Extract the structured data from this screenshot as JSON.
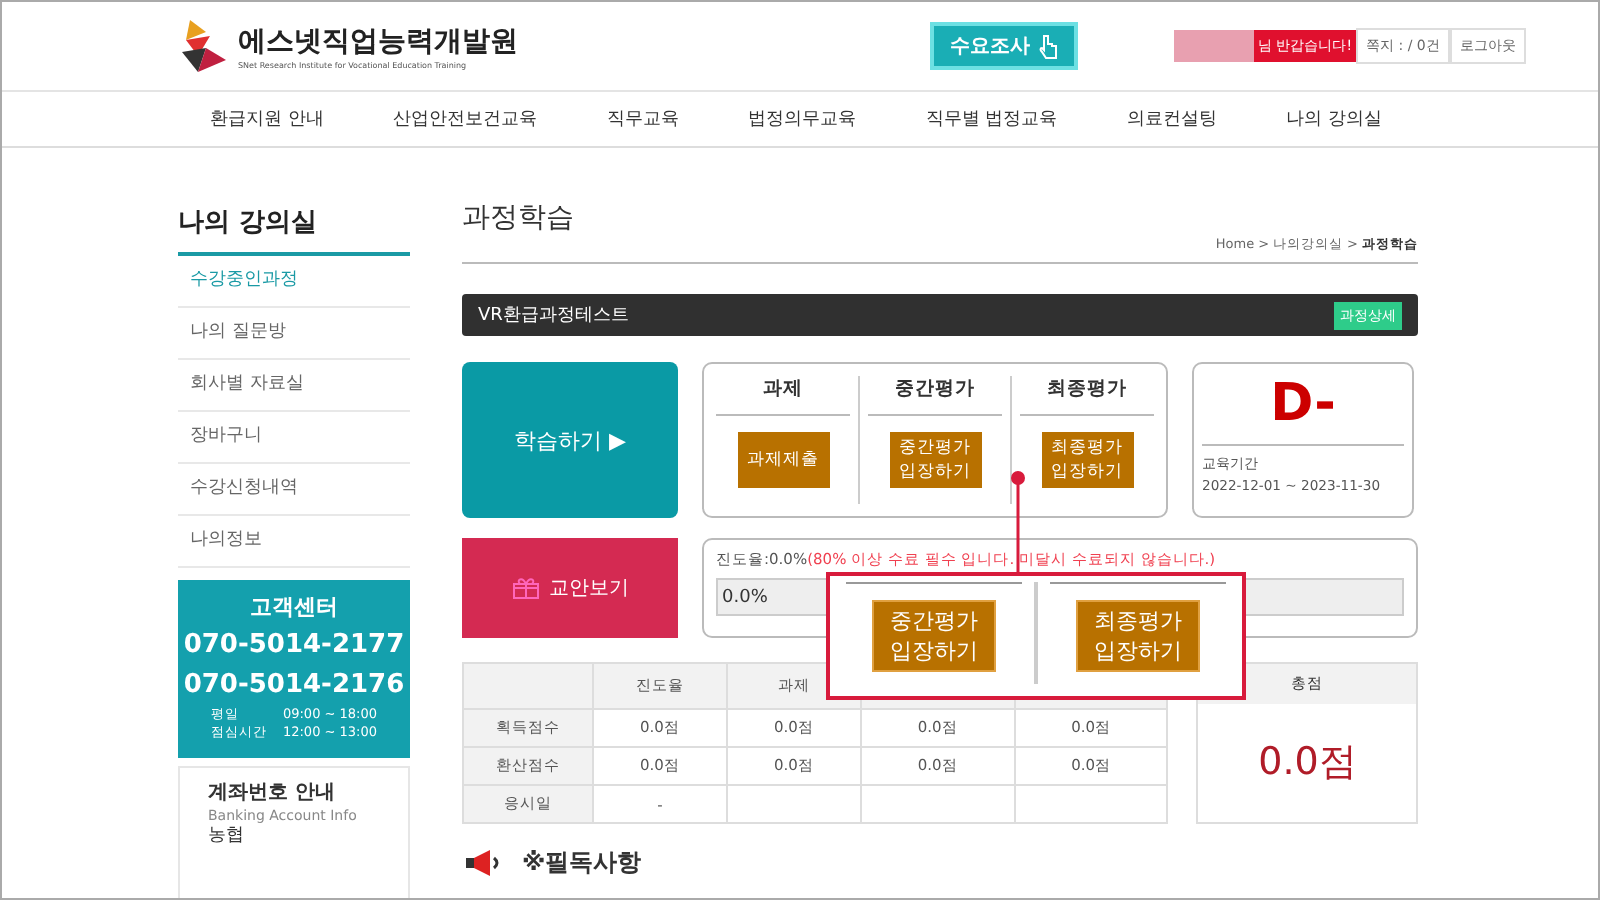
{
  "header": {
    "logo_title": "에스넷직업능력개발원",
    "logo_subtitle": "SNet Research Institute for Vocational Education Training",
    "survey_button": "수요조사",
    "greeting": "님 반갑습니다!",
    "messages": "쪽지 : / 0건",
    "logout": "로그아웃"
  },
  "nav": [
    "환급지원 안내",
    "산업안전보건교육",
    "직무교육",
    "법정의무교육",
    "직무별 법정교육",
    "의료컨설팅",
    "나의 강의실"
  ],
  "sidebar": {
    "title": "나의 강의실",
    "items": [
      {
        "label": "수강중인과정",
        "selected": true
      },
      {
        "label": "나의 질문방",
        "selected": false
      },
      {
        "label": "회사별 자료실",
        "selected": false
      },
      {
        "label": "장바구니",
        "selected": false
      },
      {
        "label": "수강신청내역",
        "selected": false
      },
      {
        "label": "나의정보",
        "selected": false
      }
    ],
    "support": {
      "title": "고객센터",
      "phones": [
        "070-5014-2177",
        "070-5014-2176"
      ],
      "hours": [
        {
          "label": "평일",
          "time": "09:00 ~ 18:00"
        },
        {
          "label": "점심시간",
          "time": "12:00 ~ 13:00"
        }
      ]
    },
    "account": {
      "title": "계좌번호 안내",
      "subtitle": "Banking Account Info",
      "bank": "농협"
    }
  },
  "page": {
    "title": "과정학습",
    "breadcrumb": [
      "Home",
      "나의강의실",
      "과정학습"
    ],
    "breadcrumb_separator": ">"
  },
  "course": {
    "name": "VR환급과정테스트",
    "detail_button": "과정상세"
  },
  "study_button": "학습하기 ▶",
  "textbook_button": "교안보기",
  "evaluations": [
    {
      "title": "과제",
      "button": "과제제출"
    },
    {
      "title": "중간평가",
      "button": "중간평가\n입장하기"
    },
    {
      "title": "최종평가",
      "button": "최종평가\n입장하기"
    }
  ],
  "grade": {
    "value": "D-",
    "period_label": "교육기간",
    "period": "2022-12-01 ~ 2023-11-30"
  },
  "progress": {
    "label": "진도율:0.0%",
    "notice": "(80% 이상 수료 필수 입니다. 미달시 수료되지 않습니다.)",
    "level": 0,
    "reading": "0.0%"
  },
  "score_table": {
    "columns": [
      "",
      "진도율",
      "과제"
    ],
    "rows": [
      {
        "cells": [
          "획득점수",
          "0.0점",
          "0.0점",
          "0.0점",
          "0.0점"
        ]
      },
      {
        "cells": [
          "환산점수",
          "0.0점",
          "0.0점",
          "0.0점",
          "0.0점"
        ]
      },
      {
        "cells": [
          "응시일",
          "-",
          "",
          "",
          ""
        ]
      }
    ]
  },
  "total": {
    "label": "총점",
    "value": "0.0점"
  },
  "callout": {
    "buttons": [
      "중간평가\n입장하기",
      "최종평가\n입장하기"
    ]
  },
  "notice_title": "※필독사항"
}
